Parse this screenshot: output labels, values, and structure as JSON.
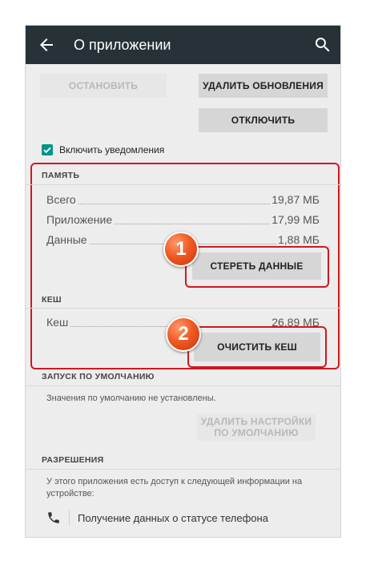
{
  "appbar": {
    "title": "О приложении"
  },
  "buttons": {
    "stop": "ОСТАНОВИТЬ",
    "uninstall_updates": "УДАЛИТЬ ОБНОВЛЕНИЯ",
    "disable": "ОТКЛЮЧИТЬ",
    "clear_data": "СТЕРЕТЬ ДАННЫЕ",
    "clear_cache": "ОЧИСТИТЬ КЕШ",
    "reset_defaults_line1": "УДАЛИТЬ НАСТРОЙКИ",
    "reset_defaults_line2": "ПО УМОЛЧАНИЮ"
  },
  "notifications": {
    "label": "Включить уведомления",
    "checked": true
  },
  "memory": {
    "header": "ПАМЯТЬ",
    "rows": [
      {
        "label": "Всего",
        "value": "19,87 МБ"
      },
      {
        "label": "Приложение",
        "value": "17,99 МБ"
      },
      {
        "label": "Данные",
        "value": "1,88 МБ"
      }
    ]
  },
  "cache": {
    "header": "КЕШ",
    "rows": [
      {
        "label": "Кеш",
        "value": "26,89 МБ"
      }
    ]
  },
  "defaults": {
    "header": "ЗАПУСК ПО УМОЛЧАНИЮ",
    "text": "Значения по умолчанию не установлены."
  },
  "permissions": {
    "header": "РАЗРЕШЕНИЯ",
    "text": "У этого приложения есть доступ к следующей информации на устройстве:",
    "items": [
      {
        "label": "Получение данных о статусе телефона",
        "icon": "phone-icon"
      }
    ]
  },
  "annotations": {
    "badge1": "1",
    "badge2": "2"
  },
  "colors": {
    "appbar": "#263238",
    "accent": "#009688",
    "highlight": "#d0181f",
    "badge": "#f05a24"
  }
}
